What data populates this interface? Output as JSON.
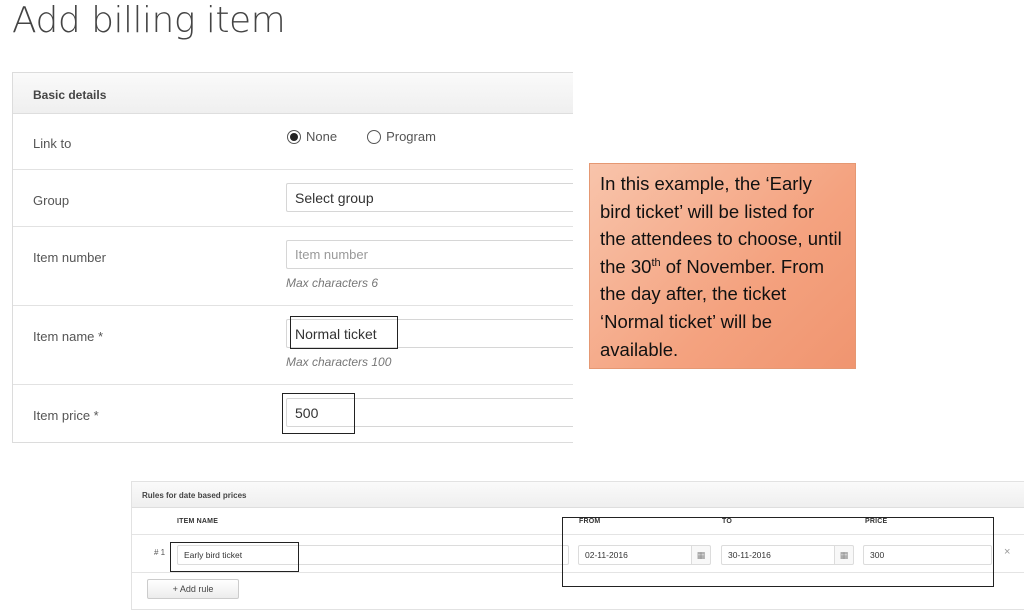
{
  "page": {
    "title": "Add billing item"
  },
  "basic_details": {
    "heading": "Basic details",
    "link_to": {
      "label": "Link to",
      "options": [
        {
          "label": "None",
          "checked": true
        },
        {
          "label": "Program",
          "checked": false
        }
      ]
    },
    "group": {
      "label": "Group",
      "value": "Select group"
    },
    "item_number": {
      "label": "Item number",
      "placeholder": "Item number",
      "hint": "Max characters 6"
    },
    "item_name": {
      "label": "Item name *",
      "value": "Normal ticket",
      "hint": "Max characters 100"
    },
    "item_price": {
      "label": "Item price *",
      "value": "500"
    }
  },
  "callout": {
    "text_before": "In this example, the ‘Early bird ticket’ will be listed for the attendees to choose, until the 30",
    "sup": "th",
    "text_after": " of November. From the day after, the ticket ‘Normal ticket’ will be available.",
    "color": "#f4a27f"
  },
  "rules": {
    "heading": "Rules for date based prices",
    "columns": {
      "item_name": "ITEM NAME",
      "from": "FROM",
      "to": "TO",
      "price": "PRICE"
    },
    "rows": [
      {
        "index": "# 1",
        "item_name": "Early bird ticket",
        "from": "02-11-2016",
        "to": "30-11-2016",
        "price": "300",
        "remove": "×"
      }
    ],
    "add_rule_label": "+ Add rule",
    "calendar_icon": "▦"
  }
}
